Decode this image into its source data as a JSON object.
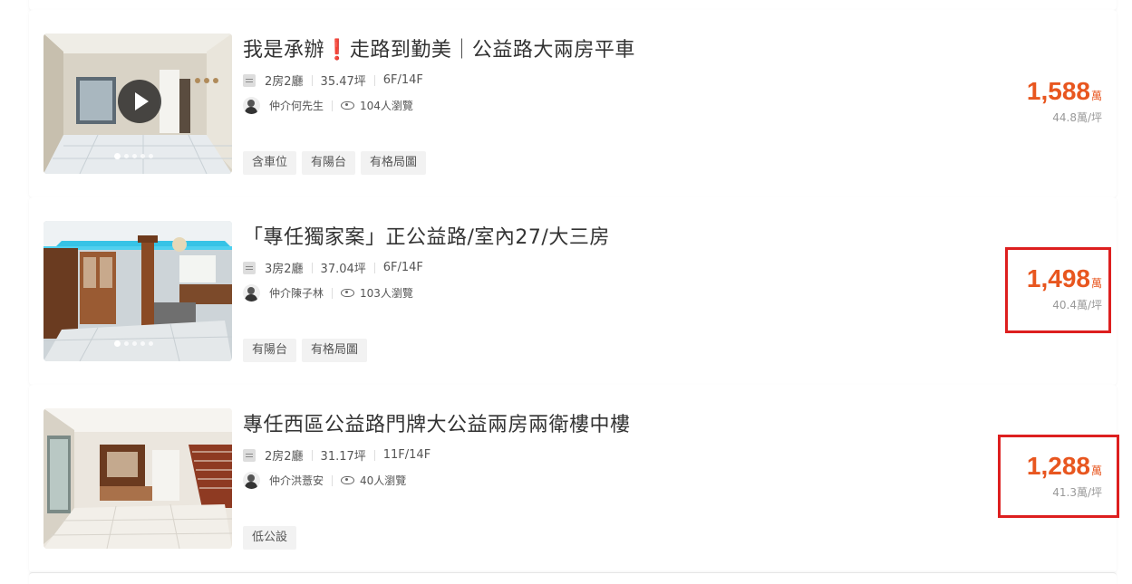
{
  "colors": {
    "price": "#e8561f",
    "highlight_box": "#dd1f1f",
    "tag_bg": "#f2f2f2"
  },
  "listings": [
    {
      "title_pre": "我是承辦",
      "title_excl": "❗",
      "title_post": "走路到勤美｜公益路大兩房平車",
      "has_video": true,
      "layout": "2房2廳",
      "area": "35.47坪",
      "floor": "6F/14F",
      "agent": "仲介何先生",
      "views": "104人瀏覽",
      "tags": [
        "含車位",
        "有陽台",
        "有格局圖"
      ],
      "price": "1,588",
      "price_unit": "萬",
      "unit_price": "44.8萬/坪"
    },
    {
      "title": "「專任獨家案」正公益路/室內27/大三房",
      "layout": "3房2廳",
      "area": "37.04坪",
      "floor": "6F/14F",
      "agent": "仲介陳子林",
      "views": "103人瀏覽",
      "tags": [
        "有陽台",
        "有格局圖"
      ],
      "price": "1,498",
      "price_unit": "萬",
      "unit_price": "40.4萬/坪"
    },
    {
      "title": "專任西區公益路門牌大公益兩房兩衛樓中樓",
      "layout": "2房2廳",
      "area": "31.17坪",
      "floor": "11F/14F",
      "agent": "仲介洪薏安",
      "views": "40人瀏覽",
      "tags": [
        "低公設"
      ],
      "price": "1,288",
      "price_unit": "萬",
      "unit_price": "41.3萬/坪"
    }
  ]
}
